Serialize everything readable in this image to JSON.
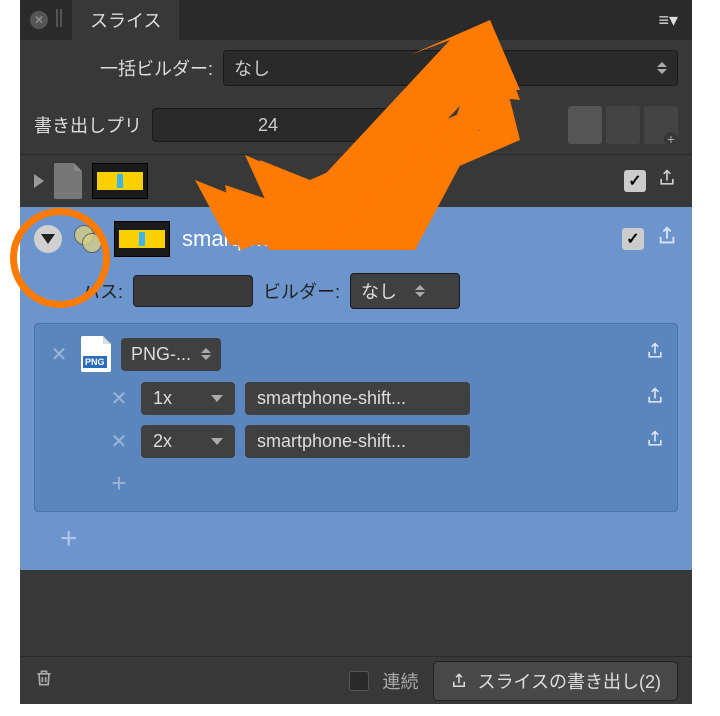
{
  "tab_title": "スライス",
  "builder_row": {
    "label": "一括ビルダー:",
    "value": "なし"
  },
  "preset_row": {
    "label": "書き出しプリ",
    "value": "24"
  },
  "slice": {
    "name": "smartphone-shift",
    "path_label": "パス:",
    "path_value": "",
    "builder_label": "ビルダー:",
    "builder_value": "なし"
  },
  "export": {
    "format": "PNG-...",
    "file_badge": "PNG",
    "scales": [
      {
        "scale": "1x",
        "filename": "smartphone-shift..."
      },
      {
        "scale": "2x",
        "filename": "smartphone-shift..."
      }
    ]
  },
  "footer": {
    "continuous_label": "連続",
    "export_label": "スライスの書き出し(2)"
  }
}
